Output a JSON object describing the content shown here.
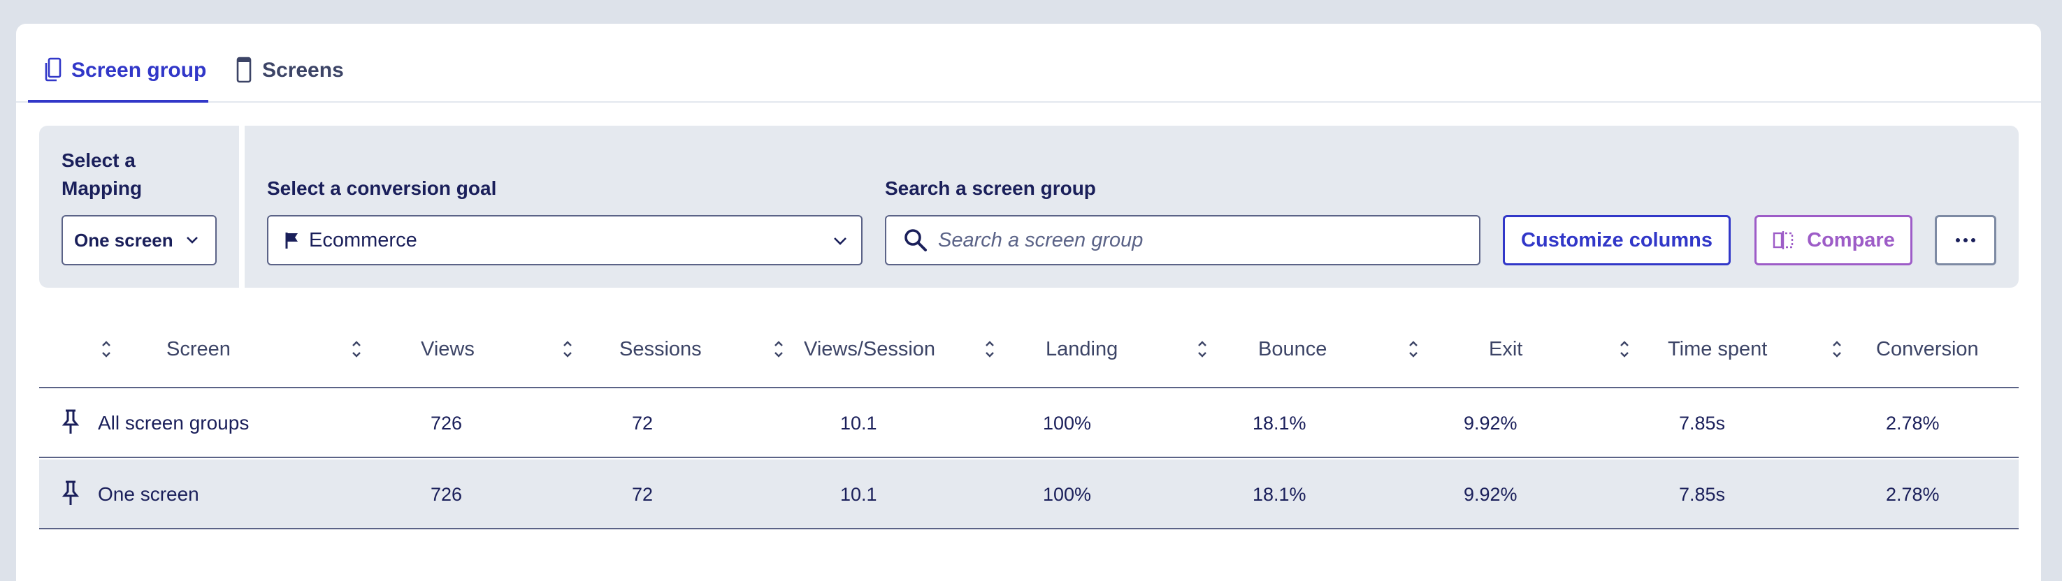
{
  "tabs": [
    {
      "label": "Screen group",
      "icon": "copy-icon",
      "active": true
    },
    {
      "label": "Screens",
      "icon": "phone-icon",
      "active": false
    }
  ],
  "filters": {
    "mapping_label": "Select a Mapping",
    "mapping_value": "One screen",
    "goal_label": "Select a conversion goal",
    "goal_value": "Ecommerce",
    "search_label": "Search a screen group",
    "search_placeholder": "Search a screen group",
    "customize_label": "Customize columns",
    "compare_label": "Compare"
  },
  "colors": {
    "accent": "#3137c8",
    "compare": "#9d5cc7",
    "text": "#1a1f5a",
    "panel": "#e5e9ef"
  },
  "table": {
    "columns": [
      "Screen",
      "Views",
      "Sessions",
      "Views/Session",
      "Landing",
      "Bounce",
      "Exit",
      "Time spent",
      "Conversion"
    ],
    "rows": [
      {
        "name": "All screen groups",
        "views": "726",
        "sessions": "72",
        "views_session": "10.1",
        "landing": "100%",
        "bounce": "18.1%",
        "exit": "9.92%",
        "time_spent": "7.85s",
        "conversion": "2.78%"
      },
      {
        "name": "One screen",
        "views": "726",
        "sessions": "72",
        "views_session": "10.1",
        "landing": "100%",
        "bounce": "18.1%",
        "exit": "9.92%",
        "time_spent": "7.85s",
        "conversion": "2.78%"
      }
    ]
  }
}
